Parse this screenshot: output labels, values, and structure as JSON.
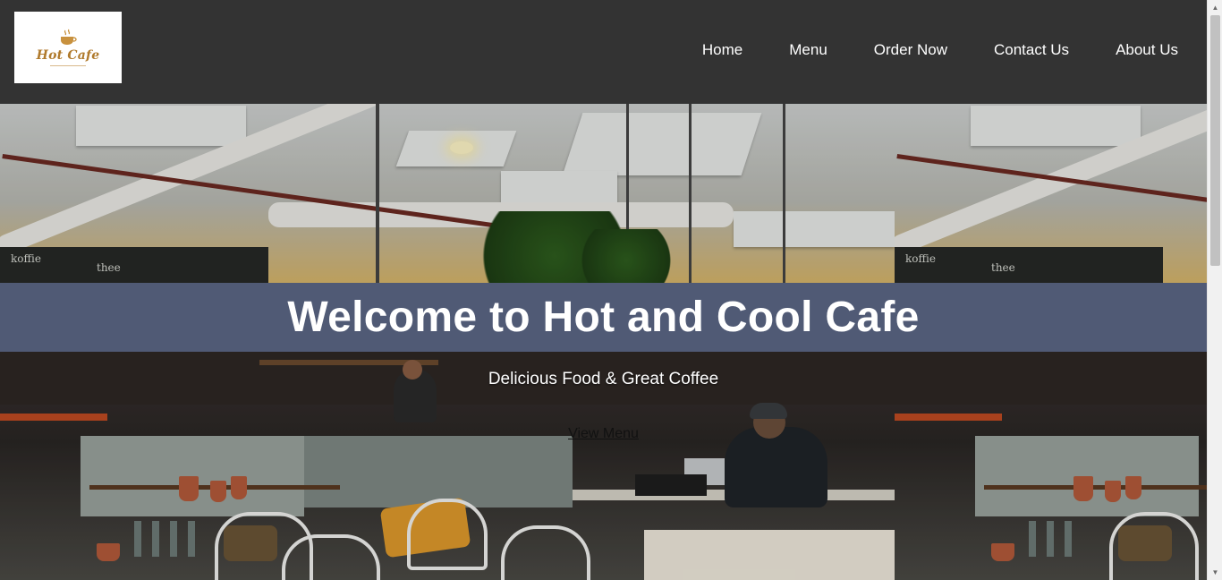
{
  "header": {
    "logo": {
      "text": "Hot Cafe",
      "icon": "coffee-cup-icon"
    },
    "nav": [
      {
        "label": "Home"
      },
      {
        "label": "Menu"
      },
      {
        "label": "Order Now"
      },
      {
        "label": "Contact Us"
      },
      {
        "label": "About Us"
      }
    ]
  },
  "hero": {
    "title": "Welcome to Hot and Cool Cafe",
    "subtitle": "Delicious Food & Great Coffee",
    "cta_label": "View Menu",
    "background": "cafe-interior-photo",
    "band_color": "#505a75"
  },
  "colors": {
    "header_bg": "#333333",
    "band_bg": "#505a75",
    "text_light": "#ffffff"
  }
}
